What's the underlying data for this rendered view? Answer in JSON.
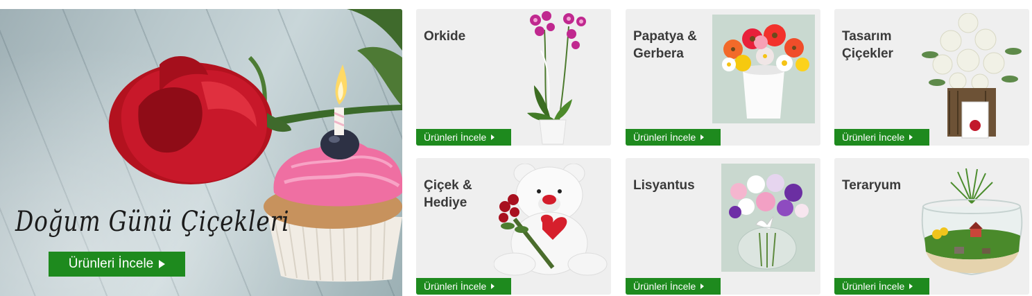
{
  "hero": {
    "title": "Doğum Günü Çiçekleri",
    "button_label": "Ürünleri İncele"
  },
  "categories": [
    {
      "title": "Orkide",
      "button_label": "Ürünleri İncele"
    },
    {
      "title": "Papatya &\nGerbera",
      "button_label": "Ürünleri İncele"
    },
    {
      "title": "Tasarım\nÇiçekler",
      "button_label": "Ürünleri İncele"
    },
    {
      "title": "Çiçek &\nHediye",
      "button_label": "Ürünleri İncele"
    },
    {
      "title": "Lisyantus",
      "button_label": "Ürünleri İncele"
    },
    {
      "title": "Teraryum",
      "button_label": "Ürünleri İncele"
    }
  ],
  "colors": {
    "accent_green": "#1e8a1e",
    "card_bg": "#efefef"
  },
  "icons": {
    "button_arrow": "play-triangle-icon"
  }
}
